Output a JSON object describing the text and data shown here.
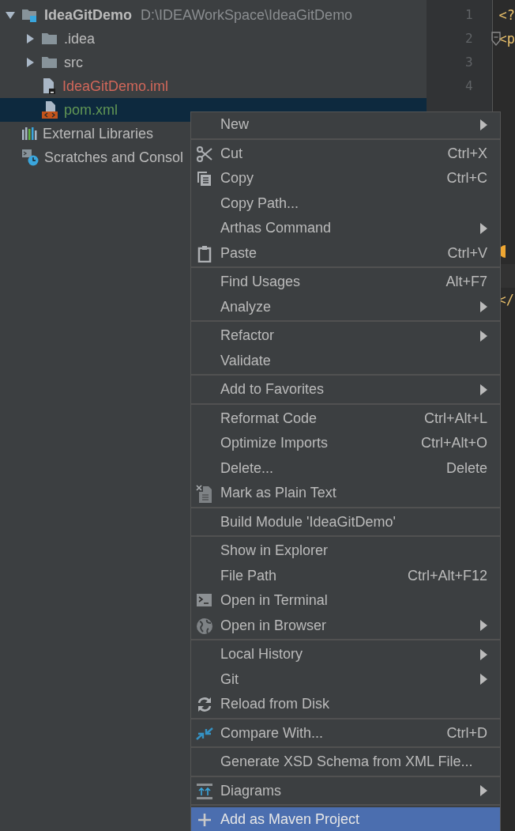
{
  "project_tree": {
    "items": [
      {
        "label": "IdeaGitDemo",
        "path": "D:\\IDEAWorkSpace\\IdeaGitDemo",
        "expanded": true,
        "selected": false,
        "color": "#bbbbbb",
        "children": [
          {
            "label": ".idea",
            "expanded": false,
            "selected": false,
            "color": "#bbbbbb"
          },
          {
            "label": "src",
            "expanded": false,
            "selected": false,
            "color": "#bbbbbb"
          },
          {
            "label": "IdeaGitDemo.iml",
            "selected": false,
            "color": "#d1675a"
          },
          {
            "label": "pom.xml",
            "selected": true,
            "color": "#629755"
          }
        ]
      },
      {
        "label": "External Libraries",
        "selected": false,
        "color": "#bbbbbb"
      },
      {
        "label": "Scratches and Consol",
        "selected": false,
        "color": "#bbbbbb"
      }
    ]
  },
  "editor": {
    "line_numbers": [
      "1",
      "2",
      "3",
      "4"
    ],
    "lines": [
      {
        "text": "<?"
      },
      {
        "text": "<p"
      }
    ],
    "closing_tag": "</"
  },
  "context_menu": {
    "groups": [
      [
        {
          "label": "New",
          "submenu": true,
          "selected": false
        }
      ],
      [
        {
          "label": "Cut",
          "shortcut": "Ctrl+X",
          "selected": false
        },
        {
          "label": "Copy",
          "shortcut": "Ctrl+C",
          "selected": false
        },
        {
          "label": "Copy Path...",
          "selected": false
        },
        {
          "label": "Arthas Command",
          "submenu": true,
          "selected": false
        },
        {
          "label": "Paste",
          "shortcut": "Ctrl+V",
          "selected": false
        }
      ],
      [
        {
          "label": "Find Usages",
          "shortcut": "Alt+F7",
          "selected": false
        },
        {
          "label": "Analyze",
          "submenu": true,
          "selected": false
        }
      ],
      [
        {
          "label": "Refactor",
          "submenu": true,
          "selected": false
        },
        {
          "label": "Validate",
          "selected": false
        }
      ],
      [
        {
          "label": "Add to Favorites",
          "submenu": true,
          "selected": false
        }
      ],
      [
        {
          "label": "Reformat Code",
          "shortcut": "Ctrl+Alt+L",
          "selected": false
        },
        {
          "label": "Optimize Imports",
          "shortcut": "Ctrl+Alt+O",
          "selected": false
        },
        {
          "label": "Delete...",
          "shortcut": "Delete",
          "selected": false
        },
        {
          "label": "Mark as Plain Text",
          "selected": false
        }
      ],
      [
        {
          "label": "Build Module 'IdeaGitDemo'",
          "selected": false
        }
      ],
      [
        {
          "label": "Show in Explorer",
          "selected": false
        },
        {
          "label": "File Path",
          "shortcut": "Ctrl+Alt+F12",
          "selected": false
        },
        {
          "label": "Open in Terminal",
          "selected": false
        },
        {
          "label": "Open in Browser",
          "submenu": true,
          "selected": false
        }
      ],
      [
        {
          "label": "Local History",
          "submenu": true,
          "selected": false
        },
        {
          "label": "Git",
          "submenu": true,
          "selected": false
        },
        {
          "label": "Reload from Disk",
          "selected": false
        }
      ],
      [
        {
          "label": "Compare With...",
          "shortcut": "Ctrl+D",
          "selected": false
        }
      ],
      [
        {
          "label": "Generate XSD Schema from XML File...",
          "selected": false
        }
      ],
      [
        {
          "label": "Diagrams",
          "submenu": true,
          "selected": false
        }
      ],
      [
        {
          "label": "Add as Maven Project",
          "selected": true
        }
      ]
    ]
  }
}
